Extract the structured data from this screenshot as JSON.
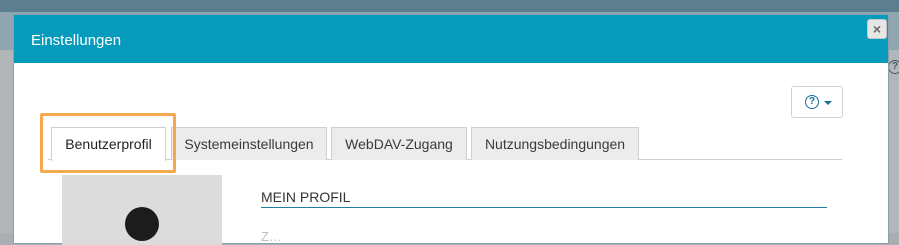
{
  "dialog": {
    "title": "Einstellungen",
    "close_label": "×",
    "help_label": "?"
  },
  "tabs": [
    {
      "label": "Benutzerprofil",
      "active": true
    },
    {
      "label": "Systemeinstellungen",
      "active": false
    },
    {
      "label": "WebDAV-Zugang",
      "active": false
    },
    {
      "label": "Nutzungsbedingungen",
      "active": false
    }
  ],
  "profile": {
    "heading": "MEIN PROFIL",
    "intro_text": "Z..."
  },
  "background": {
    "help_label": "?"
  },
  "colors": {
    "header": "#069bbc",
    "highlight": "#f4a951",
    "accent_rule": "#1a7fa0"
  }
}
